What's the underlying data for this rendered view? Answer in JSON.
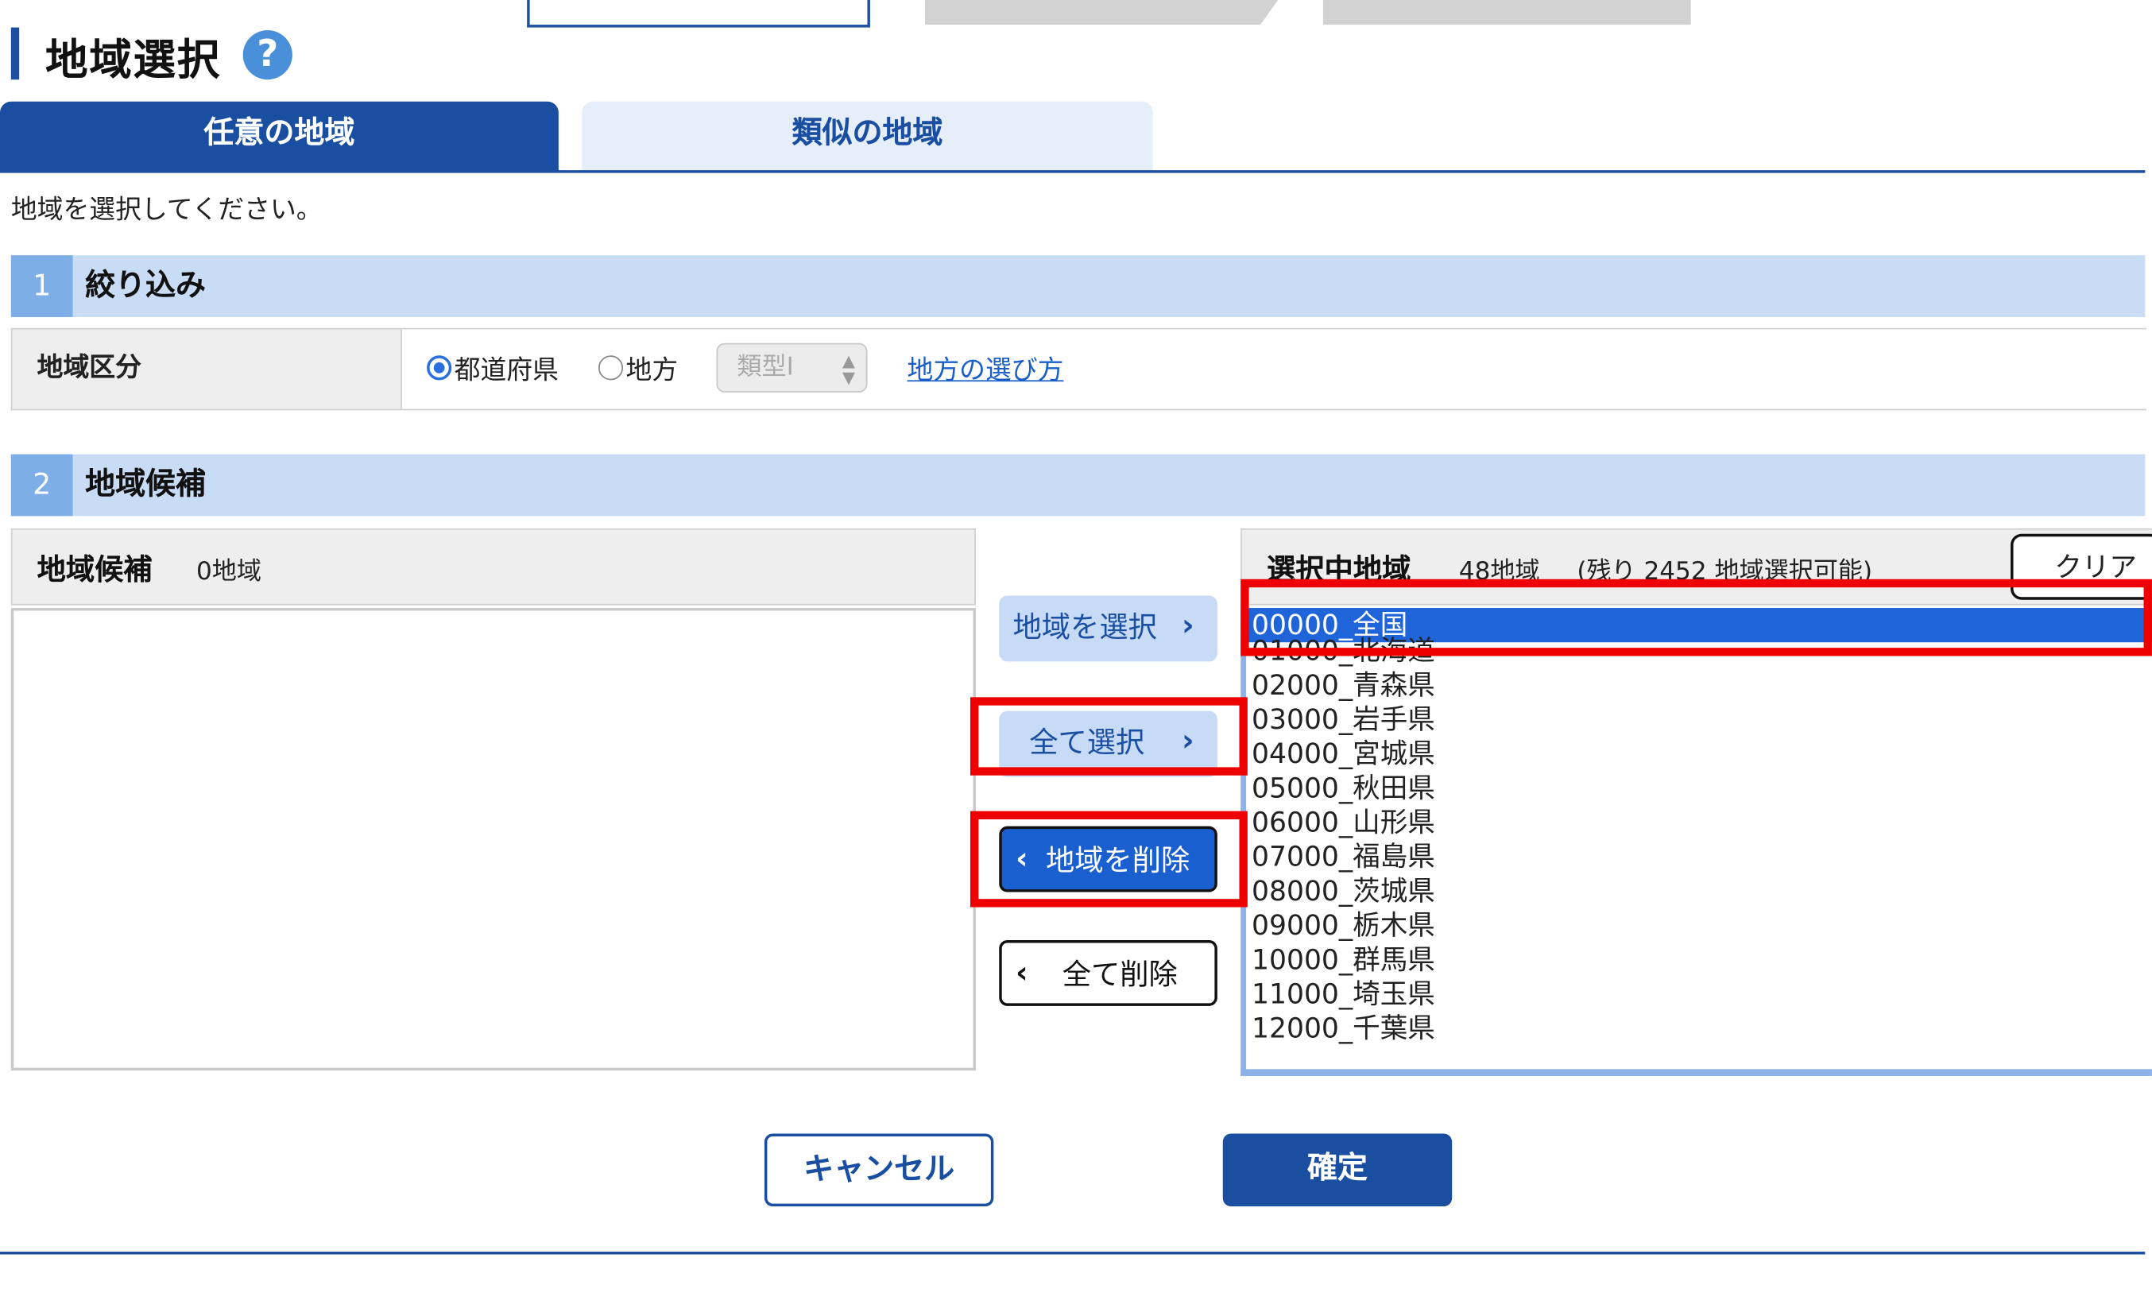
{
  "page": {
    "title": "地域選択",
    "help_icon": "?"
  },
  "tabs": [
    {
      "label": "任意の地域",
      "active": true
    },
    {
      "label": "類似の地域",
      "active": false
    }
  ],
  "instruction": "地域を選択してください。",
  "section1": {
    "number": "1",
    "label": "絞り込み",
    "row_label": "地域区分",
    "radio_prefecture": "都道府県",
    "radio_region": "地方",
    "selected_radio": "都道府県",
    "type_select_value": "類型Ⅰ",
    "help_link": "地方の選び方"
  },
  "section2": {
    "number": "2",
    "label": "地域候補"
  },
  "candidates": {
    "title": "地域候補",
    "count": "0地域",
    "items": []
  },
  "selected": {
    "title": "選択中地域",
    "count": "48地域",
    "remaining": "(残り 2452 地域選択可能)",
    "clear_label": "クリア",
    "items": [
      "00000_全国",
      "01000_北海道",
      "02000_青森県",
      "03000_岩手県",
      "04000_宮城県",
      "05000_秋田県",
      "06000_山形県",
      "07000_福島県",
      "08000_茨城県",
      "09000_栃木県",
      "10000_群馬県",
      "11000_埼玉県",
      "12000_千葉県"
    ],
    "highlighted_index": 0
  },
  "actions": {
    "select": "地域を選択",
    "select_all": "全て選択",
    "remove": "地域を削除",
    "remove_all": "全て削除"
  },
  "footer": {
    "cancel": "キャンセル",
    "confirm": "確定"
  },
  "colors": {
    "primary": "#1a4ea1",
    "section_bg": "#c9dcf6",
    "highlight": "#1f64d8",
    "annotation": "#ee0000"
  },
  "icons": {
    "chevron_right": "chevron-right-icon",
    "chevron_left": "chevron-left-icon",
    "help": "question-icon"
  }
}
